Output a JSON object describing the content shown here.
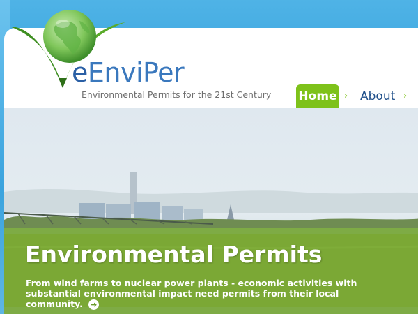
{
  "logo": {
    "brand_prefix": "e",
    "brand_main": "EnviPer",
    "tagline": "Environmental Permits for the 21st Century",
    "icon": "globe-leaf-icon"
  },
  "nav": {
    "items": [
      {
        "label": "Home",
        "active": true
      },
      {
        "label": "About",
        "active": false
      }
    ],
    "separator": "›",
    "active_color": "#7ec21a"
  },
  "hero": {
    "title": "Environmental Permits",
    "text": "From wind farms to nuclear power plants - economic activities with substantial environmental impact need permits from their local community.",
    "more_icon": "arrow-right-icon"
  },
  "colors": {
    "sky": "#2a9ad9",
    "brand_blue": "#2a5fa5",
    "accent_green": "#7ec21a"
  }
}
